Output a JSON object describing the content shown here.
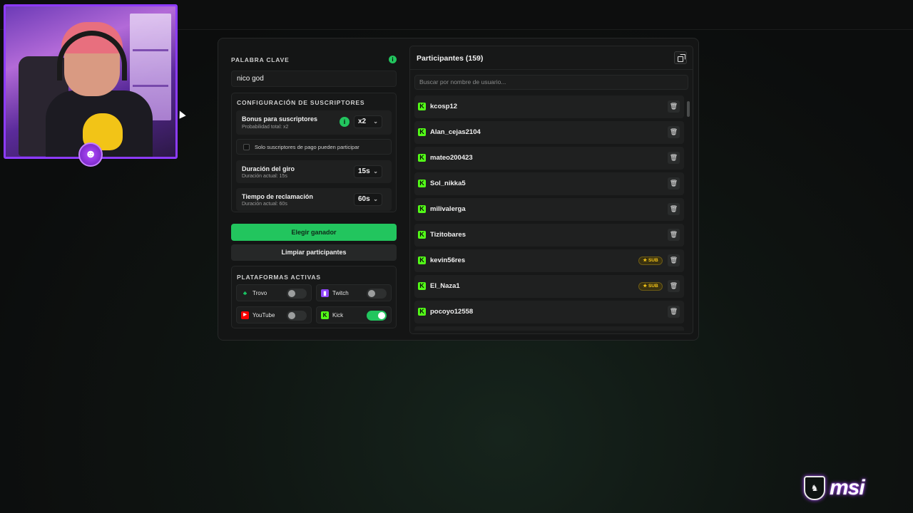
{
  "keyword": {
    "label": "PALABRA CLAVE",
    "value": "nico god"
  },
  "subscribers": {
    "section_label": "CONFIGURACIÓN DE SUSCRIPTORES",
    "bonus": {
      "title": "Bonus para suscriptores",
      "sub": "Probabilidad total: x2",
      "value": "x2"
    },
    "paid_only": {
      "label": "Solo suscriptores de pago pueden participar",
      "checked": false
    },
    "spin": {
      "title": "Duración del giro",
      "sub": "Duración actual: 15s",
      "value": "15s"
    },
    "claim": {
      "title": "Tiempo de reclamación",
      "sub": "Duración actual: 60s",
      "value": "60s"
    }
  },
  "actions": {
    "pick_winner": "Elegir ganador",
    "clear": "Limpiar participantes"
  },
  "platforms": {
    "section_label": "PLATAFORMAS ACTIVAS",
    "items": [
      {
        "name": "Trovo",
        "enabled": false,
        "icon": "trovo-icon",
        "color": "#19d66b"
      },
      {
        "name": "Twitch",
        "enabled": false,
        "icon": "twitch-icon",
        "color": "#9146ff"
      },
      {
        "name": "YouTube",
        "enabled": false,
        "icon": "youtube-icon",
        "color": "#ff0000"
      },
      {
        "name": "Kick",
        "enabled": true,
        "icon": "kick-icon",
        "color": "#53fc18"
      }
    ]
  },
  "participants": {
    "title": "Participantes (159)",
    "search_placeholder": "Buscar por nombre de usuario...",
    "sub_badge": "★ SUB",
    "list": [
      {
        "name": "kcosp12",
        "sub": false
      },
      {
        "name": "Alan_cejas2104",
        "sub": false
      },
      {
        "name": "mateo200423",
        "sub": false
      },
      {
        "name": "Sol_nikka5",
        "sub": false
      },
      {
        "name": "milivalerga",
        "sub": false
      },
      {
        "name": "Tizitobares",
        "sub": false
      },
      {
        "name": "kevin56res",
        "sub": true
      },
      {
        "name": "El_Naza1",
        "sub": true
      },
      {
        "name": "pocoyo12558",
        "sub": false
      }
    ]
  },
  "brand": {
    "name": "msi"
  },
  "colors": {
    "accent": "#22c55e",
    "kick": "#53fc18",
    "webcam_border": "#8d3bff"
  }
}
